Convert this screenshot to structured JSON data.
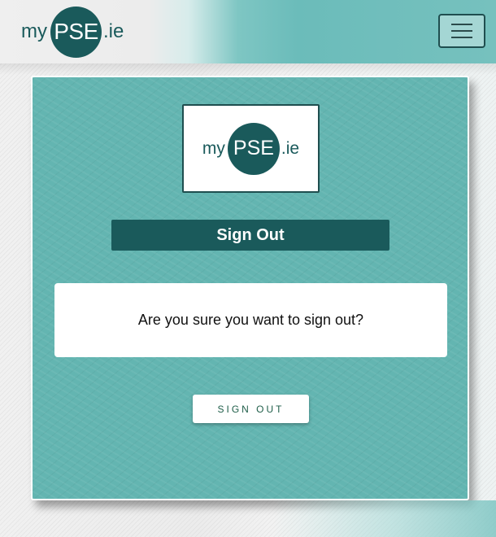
{
  "navbar": {
    "brand": {
      "my": "my",
      "pse": "PSE",
      "ie": ".ie"
    },
    "menu_icon": "hamburger-icon"
  },
  "card": {
    "logo": {
      "my": "my",
      "pse": "PSE",
      "ie": ".ie"
    },
    "heading": "Sign Out",
    "message": "Are you sure you want to sign out?",
    "button_label": "SIGN OUT"
  },
  "colors": {
    "brand_dark": "#1a5a5b",
    "card_teal": "#63b5b1",
    "button_text": "#1e5d48"
  }
}
